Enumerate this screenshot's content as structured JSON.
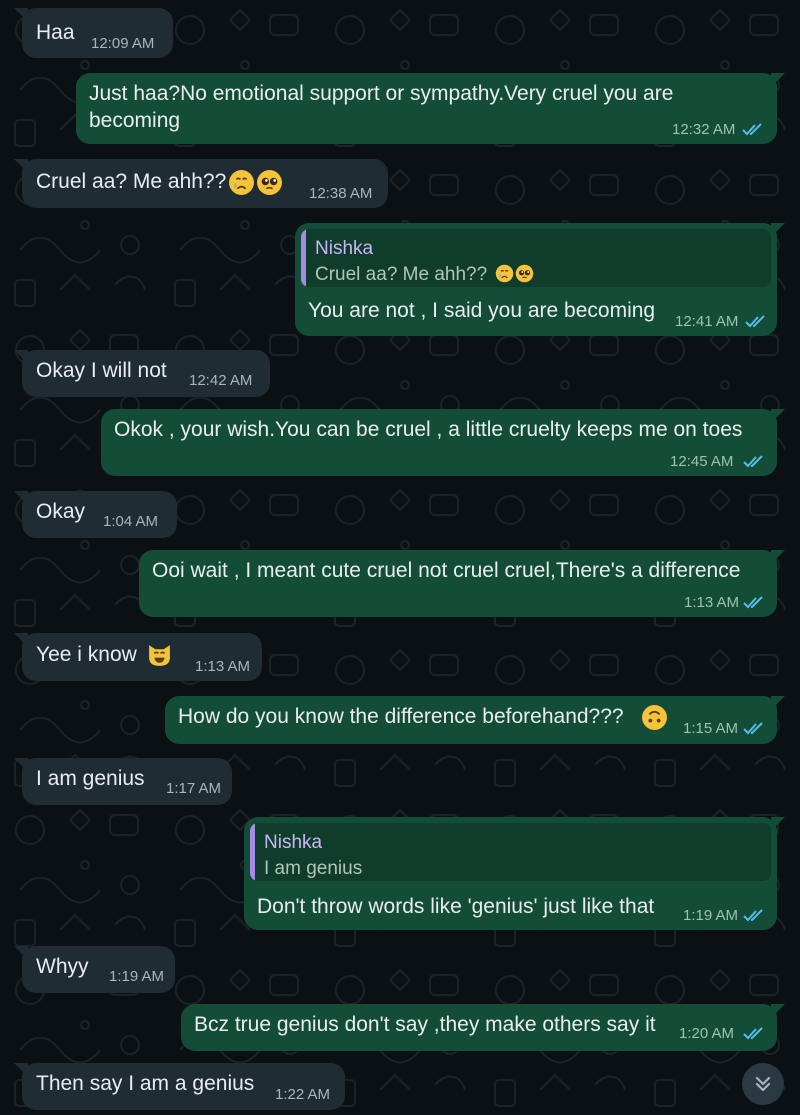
{
  "colors": {
    "background": "#0b1014",
    "incoming_bubble": "#1f2c33",
    "outgoing_bubble": "#134d37",
    "read_ticks": "#53bdeb",
    "quote_bar": "#a58be3"
  },
  "messages": [
    {
      "dir": "in",
      "text": "Haa",
      "time": "12:09 AM"
    },
    {
      "dir": "out",
      "line1": "Just haa?No emotional support or sympathy.Very cruel you are",
      "line2": "becoming",
      "time": "12:32 AM",
      "status": "read"
    },
    {
      "dir": "in",
      "text": "Cruel aa? Me ahh??",
      "emojis": [
        "crying-face-emoji",
        "pleading-face-emoji"
      ],
      "time": "12:38 AM"
    },
    {
      "dir": "out",
      "quote_name": "Nishka",
      "quote_text": "Cruel aa? Me ahh??",
      "quote_emojis": [
        "crying-face-emoji",
        "pleading-face-emoji"
      ],
      "text": "You are not , I said you are becoming",
      "time": "12:41 AM",
      "status": "read"
    },
    {
      "dir": "in",
      "text": "Okay I will not",
      "time": "12:42 AM"
    },
    {
      "dir": "out",
      "text": "Okok , your wish.You can be cruel , a little cruelty keeps me on toes",
      "time": "12:45 AM",
      "status": "read"
    },
    {
      "dir": "in",
      "text": "Okay",
      "time": "1:04 AM"
    },
    {
      "dir": "out",
      "text": "Ooi wait , I meant cute cruel not cruel cruel,There's a difference",
      "time": "1:13 AM",
      "status": "read"
    },
    {
      "dir": "in",
      "text": "Yee i know",
      "emojis": [
        "grinning-cat-emoji"
      ],
      "time": "1:13 AM"
    },
    {
      "dir": "out",
      "text": "How do you know the difference beforehand???",
      "emojis": [
        "upside-down-face-emoji"
      ],
      "time": "1:15 AM",
      "status": "read"
    },
    {
      "dir": "in",
      "text": "I am genius",
      "time": "1:17 AM"
    },
    {
      "dir": "out",
      "quote_name": "Nishka",
      "quote_text": "I am genius",
      "text": "Don't throw words like 'genius' just like that",
      "time": "1:19 AM",
      "status": "read"
    },
    {
      "dir": "in",
      "text": "Whyy",
      "time": "1:19 AM"
    },
    {
      "dir": "out",
      "text": "Bcz true genius don't say ,they make others say it",
      "time": "1:20 AM",
      "status": "read"
    },
    {
      "dir": "in",
      "text": "Then say I am a genius",
      "time": "1:22 AM"
    }
  ],
  "scroll_button": {
    "icon": "double-chevron-down-icon"
  }
}
